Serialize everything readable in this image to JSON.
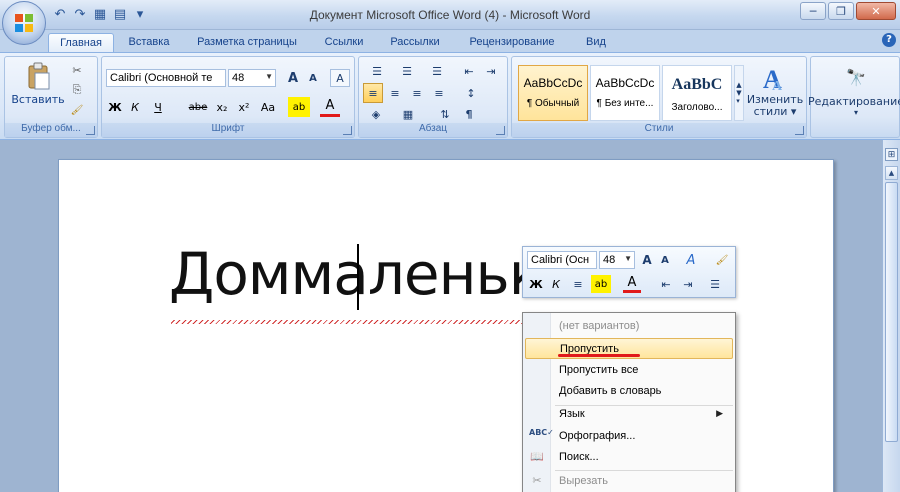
{
  "window": {
    "title": "Документ Microsoft Office Word (4) - Microsoft Word",
    "minimize": "─",
    "restore": "❐",
    "close": "✕"
  },
  "qat": {
    "undo": "↶",
    "redo": "↷",
    "print_preview": "▦",
    "print": "▤",
    "customize": "▾"
  },
  "tabs": [
    {
      "label": "Главная",
      "active": true
    },
    {
      "label": "Вставка"
    },
    {
      "label": "Разметка страницы"
    },
    {
      "label": "Ссылки"
    },
    {
      "label": "Рассылки"
    },
    {
      "label": "Рецензирование"
    },
    {
      "label": "Вид"
    }
  ],
  "help": "?",
  "ribbon": {
    "clipboard": {
      "label": "Буфер обм...",
      "paste": "Вставить",
      "cut": "✂",
      "copy": "⎘",
      "format_painter": "🖌"
    },
    "font": {
      "label": "Шрифт",
      "font_name": "Calibri (Основной те",
      "font_size": "48",
      "grow": "A",
      "shrink": "A",
      "clear": "A",
      "bold": "Ж",
      "italic": "К",
      "underline": "Ч",
      "strike": "abe",
      "subscript": "x₂",
      "superscript": "x²",
      "case": "Aa",
      "highlight": "ab",
      "color": "A"
    },
    "paragraph": {
      "label": "Абзац",
      "bullets": "☰",
      "numbering": "☰",
      "multilevel": "☰",
      "decrease_indent": "⇤",
      "increase_indent": "⇥",
      "align_left": "≡",
      "center": "≡",
      "align_right": "≡",
      "justify": "≡",
      "line_spacing": "↕",
      "shading": "◈",
      "borders": "▦",
      "sort": "⇅",
      "show_marks": "¶"
    },
    "styles": {
      "label": "Стили",
      "items": [
        {
          "sample": "AaBbCcDc",
          "name": "¶ Обычный",
          "selected": true
        },
        {
          "sample": "AaBbCcDc",
          "name": "¶ Без инте..."
        },
        {
          "sample": "AaBbC",
          "name": "Заголово..."
        }
      ],
      "change_styles": "Изменить стили",
      "change_styles_line1": "Изменить",
      "change_styles_line2": "стили ▾"
    },
    "editing": {
      "label": "Редактирование",
      "icon": "🔭"
    }
  },
  "document": {
    "text": "Доммаленьки"
  },
  "mini_toolbar": {
    "font_name": "Calibri (Осн",
    "font_size": "48",
    "grow": "A",
    "shrink": "A",
    "styles": "A",
    "painter": "🖌",
    "bold": "Ж",
    "italic": "К",
    "center": "≡",
    "highlight": "ab",
    "color": "A",
    "dec_indent": "⇤",
    "inc_indent": "⇥",
    "bullets": "☰"
  },
  "context_menu": {
    "no_suggestions": "(нет вариантов)",
    "ignore": "Пропустить",
    "ignore_all": "Пропустить все",
    "add_to_dictionary": "Добавить в словарь",
    "language": "Язык",
    "spelling": "Орфография...",
    "search": "Поиск...",
    "cut": "Вырезать"
  }
}
